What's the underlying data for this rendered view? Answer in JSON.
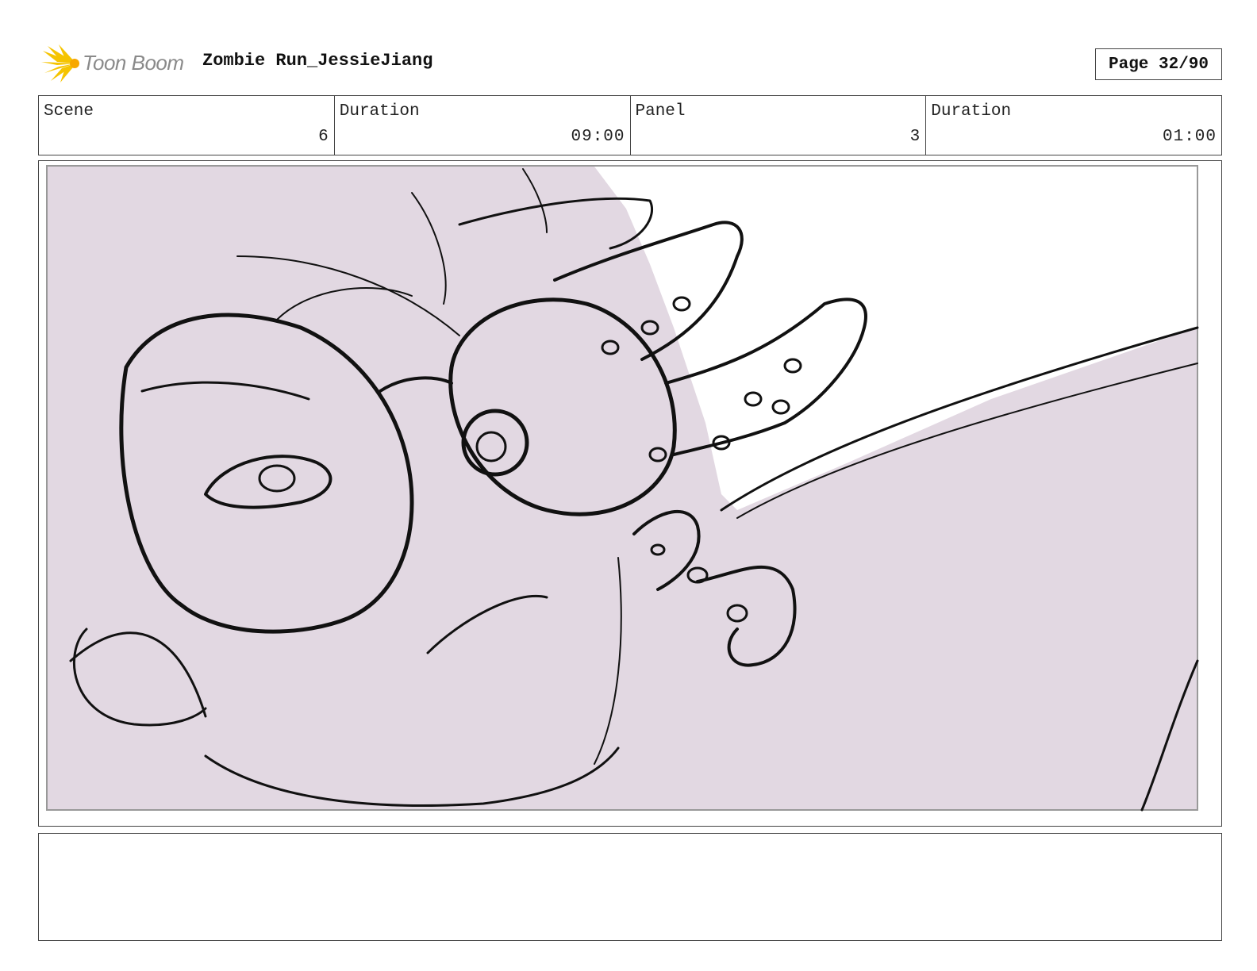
{
  "header": {
    "logo_text": "Toon Boom",
    "project_title": "Zombie Run_JessieJiang",
    "page_indicator": "Page 32/90"
  },
  "info": {
    "scene_label": "Scene",
    "scene_value": "6",
    "scene_duration_label": "Duration",
    "scene_duration_value": "09:00",
    "panel_label": "Panel",
    "panel_value": "3",
    "panel_duration_label": "Duration",
    "panel_duration_value": "01:00"
  },
  "colors": {
    "sketch_fill": "#e2d8e2",
    "sketch_line": "#111111"
  },
  "notes": {
    "text": ""
  }
}
